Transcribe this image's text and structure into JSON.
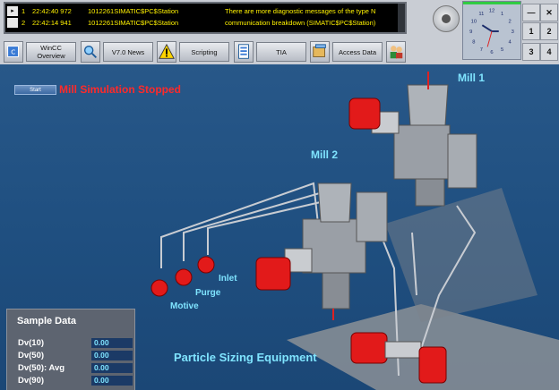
{
  "alarms": [
    {
      "index": "1",
      "time": "22:42:40 972",
      "source": "1012261SIMATIC$PC$Station",
      "message": "There are more diagnostic messages of the type N"
    },
    {
      "index": "2",
      "time": "22:42:14 941",
      "source": "1012261SIMATIC$PC$Station",
      "message": "communication breakdown (SIMATIC$PC$Station)"
    }
  ],
  "toolbar": {
    "wincc_label": "WinCC Overview",
    "news_label": "V7.0 News",
    "scripting_label": "Scripting",
    "tia_label": "TIA",
    "access_label": "Access Data"
  },
  "window_buttons": {
    "minimize": "—",
    "close": "✕",
    "one": "1",
    "two": "2",
    "three": "3",
    "four": "4"
  },
  "clock": {
    "numbers": [
      "12",
      "1",
      "2",
      "3",
      "4",
      "5",
      "6",
      "7",
      "8",
      "9",
      "10",
      "11"
    ]
  },
  "main": {
    "start_label": "Start",
    "status": "Mill Simulation Stopped",
    "mill1": "Mill 1",
    "mill2": "Mill 2",
    "inlet": "Inlet",
    "purge": "Purge",
    "motive": "Motive",
    "equipment": "Particle Sizing Equipment"
  },
  "sample": {
    "title": "Sample Data",
    "rows": [
      {
        "label": "Dv(10)",
        "value": "0.00"
      },
      {
        "label": "Dv(50)",
        "value": "0.00"
      },
      {
        "label": "Dv(50): Avg",
        "value": "0.00"
      },
      {
        "label": "Dv(90)",
        "value": "0.00"
      }
    ]
  },
  "colors": {
    "background": "#1f4f80",
    "status": "#ff2a2a",
    "label": "#7fe4ff",
    "alarm_text": "#fff200"
  }
}
